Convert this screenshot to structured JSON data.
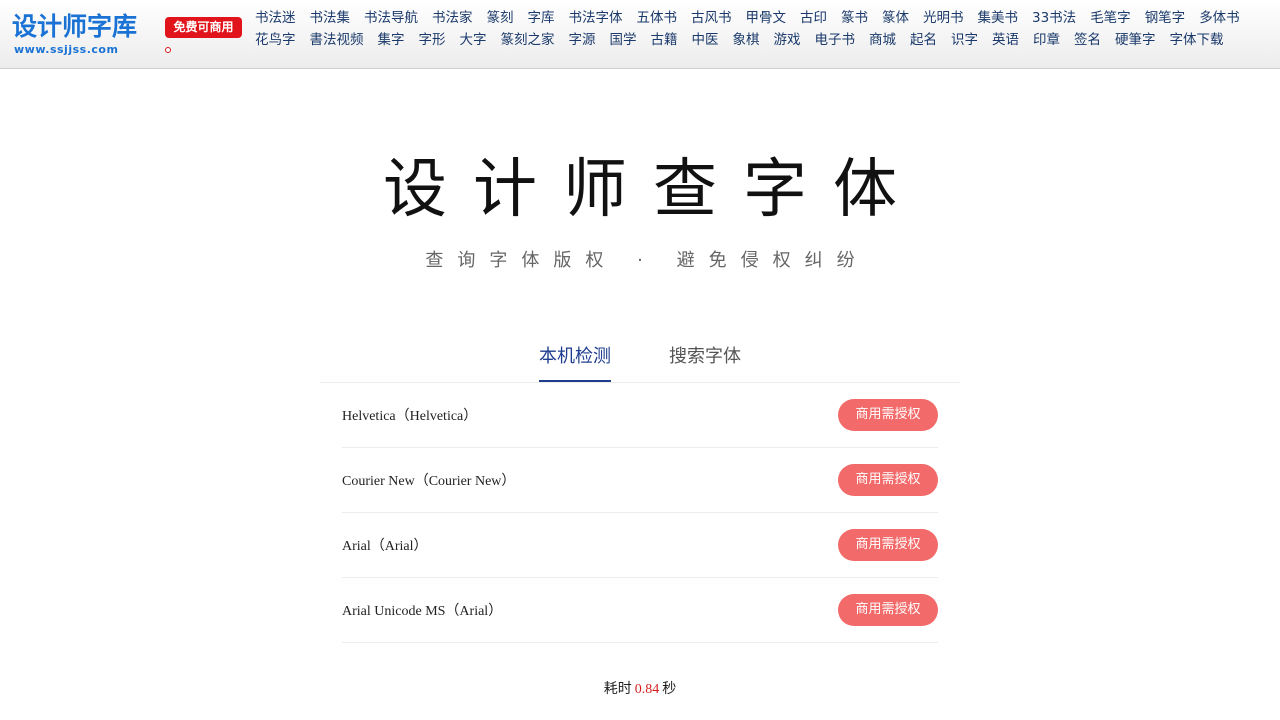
{
  "logo": {
    "title": "设计师字库",
    "url": "www.ssjjss.com",
    "badge": "免费可商用"
  },
  "nav": {
    "row1": [
      "书法迷",
      "书法集",
      "书法导航",
      "书法家",
      "篆刻",
      "字库",
      "书法字体",
      "五体书",
      "古风书",
      "甲骨文",
      "古印",
      "篆书",
      "篆体",
      "光明书",
      "集美书",
      "33书法",
      "毛笔字",
      "钢笔字",
      "多体书"
    ],
    "row2": [
      "花鸟字",
      "書法视频",
      "集字",
      "字形",
      "大字",
      "篆刻之家",
      "字源",
      "国学",
      "古籍",
      "中医",
      "象棋",
      "游戏",
      "电子书",
      "商城",
      "起名",
      "识字",
      "英语",
      "印章",
      "签名",
      "硬筆字",
      "字体下载"
    ]
  },
  "hero": {
    "title": "设计师查字体",
    "subtitle": "查询字体版权 · 避免侵权纠纷"
  },
  "tabs": [
    {
      "label": "本机检测",
      "active": true
    },
    {
      "label": "搜索字体",
      "active": false
    }
  ],
  "fonts": [
    {
      "name": "Helvetica（Helvetica）",
      "status": "商用需授权"
    },
    {
      "name": "Courier New（Courier New）",
      "status": "商用需授权"
    },
    {
      "name": "Arial（Arial）",
      "status": "商用需授权"
    },
    {
      "name": "Arial Unicode MS（Arial）",
      "status": "商用需授权"
    }
  ],
  "timing": {
    "prefix": "耗时",
    "value": "0.84",
    "unit": "秒"
  },
  "colors": {
    "brand": "#1a73d4",
    "badge": "#e1141b",
    "tab_active": "#1f3d8f",
    "license_button": "#f26a6a",
    "timing_value": "#d62020"
  }
}
